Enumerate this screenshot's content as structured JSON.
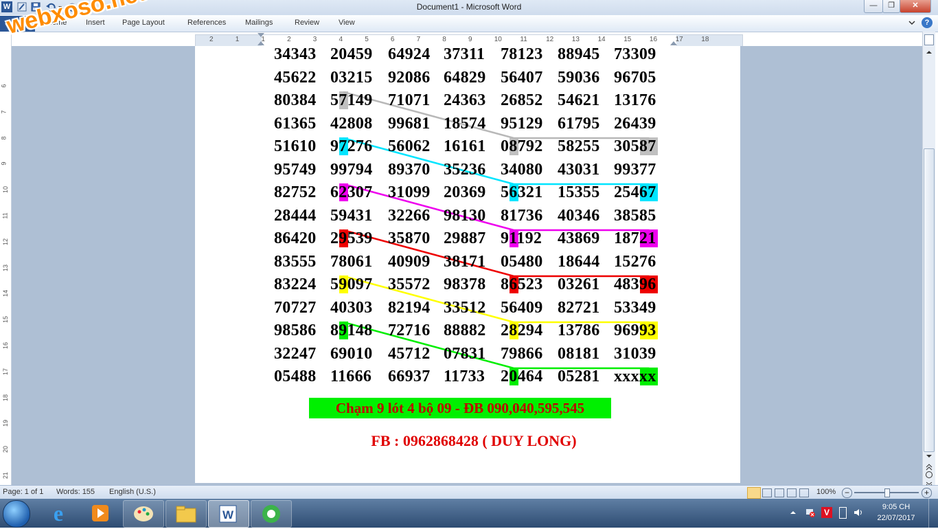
{
  "window": {
    "title": "Document1 - Microsoft Word"
  },
  "ribbon": {
    "tabs": [
      "File",
      "Home",
      "Insert",
      "Page Layout",
      "References",
      "Mailings",
      "Review",
      "View"
    ]
  },
  "watermark": "webxoso.net",
  "ruler": {
    "marks": [
      "2",
      "1",
      "1",
      "2",
      "3",
      "4",
      "5",
      "6",
      "7",
      "8",
      "9",
      "10",
      "11",
      "12",
      "13",
      "14",
      "15",
      "16",
      "17",
      "18"
    ]
  },
  "vruler": {
    "marks": [
      "6",
      "7",
      "8",
      "9",
      "10",
      "11",
      "12",
      "13",
      "14",
      "15",
      "16",
      "17",
      "18",
      "19",
      "20",
      "21"
    ]
  },
  "grid": {
    "rows": [
      [
        "34343",
        "20459",
        "64924",
        "37311",
        "78123",
        "88945",
        "73309"
      ],
      [
        "45622",
        "03215",
        "92086",
        "64829",
        "56407",
        "59036",
        "96705"
      ],
      [
        "80384",
        "57149",
        "71071",
        "24363",
        "26852",
        "54621",
        "13176"
      ],
      [
        "61365",
        "42808",
        "99681",
        "18574",
        "95129",
        "61795",
        "26439"
      ],
      [
        "51610",
        "97276",
        "56062",
        "16161",
        "08792",
        "58255",
        "30587"
      ],
      [
        "95749",
        "99794",
        "89370",
        "35236",
        "34080",
        "43031",
        "99377"
      ],
      [
        "82752",
        "62307",
        "31099",
        "20369",
        "56321",
        "15355",
        "25467"
      ],
      [
        "28444",
        "59431",
        "32266",
        "98130",
        "81736",
        "40346",
        "38585"
      ],
      [
        "86420",
        "29539",
        "35870",
        "29887",
        "91192",
        "43869",
        "18721"
      ],
      [
        "83555",
        "78061",
        "40909",
        "38171",
        "05480",
        "18644",
        "15276"
      ],
      [
        "83224",
        "59097",
        "35572",
        "98378",
        "86523",
        "03261",
        "48396"
      ],
      [
        "70727",
        "40303",
        "82194",
        "33512",
        "56409",
        "82721",
        "53349"
      ],
      [
        "98586",
        "89148",
        "72716",
        "88882",
        "28294",
        "13786",
        "96993"
      ],
      [
        "32247",
        "69010",
        "45712",
        "07831",
        "79866",
        "08181",
        "31039"
      ],
      [
        "05488",
        "11666",
        "66937",
        "11733",
        "20464",
        "05281",
        "xxxxx"
      ]
    ],
    "highlights": [
      {
        "color": "#c0c0c0",
        "cells": [
          [
            2,
            1,
            1,
            1
          ],
          [
            4,
            4,
            1,
            1
          ],
          [
            4,
            6,
            3,
            2
          ]
        ]
      },
      {
        "color": "#00e5ff",
        "cells": [
          [
            4,
            1,
            1,
            1
          ],
          [
            6,
            4,
            1,
            1
          ],
          [
            6,
            6,
            3,
            2
          ]
        ]
      },
      {
        "color": "#ee00ee",
        "cells": [
          [
            6,
            1,
            1,
            1
          ],
          [
            8,
            4,
            1,
            1
          ],
          [
            8,
            6,
            3,
            2
          ]
        ]
      },
      {
        "color": "#ee0000",
        "cells": [
          [
            8,
            1,
            1,
            1
          ],
          [
            10,
            4,
            1,
            1
          ],
          [
            10,
            6,
            3,
            2
          ]
        ]
      },
      {
        "color": "#ffff00",
        "cells": [
          [
            10,
            1,
            1,
            1
          ],
          [
            12,
            4,
            1,
            1
          ],
          [
            12,
            6,
            3,
            2
          ]
        ]
      },
      {
        "color": "#00ee00",
        "cells": [
          [
            12,
            1,
            1,
            1
          ],
          [
            14,
            4,
            1,
            1
          ],
          [
            14,
            6,
            3,
            2
          ]
        ]
      }
    ]
  },
  "caption": "Chạm 9 lót 4 bộ 09 - ĐB 090,040,595,545",
  "contact": "FB : 0962868428 ( DUY LONG)",
  "status": {
    "page": "Page: 1 of 1",
    "words": "Words: 155",
    "language": "English (U.S.)",
    "zoom": "100%"
  },
  "clock": {
    "time": "9:05 CH",
    "date": "22/07/2017"
  }
}
